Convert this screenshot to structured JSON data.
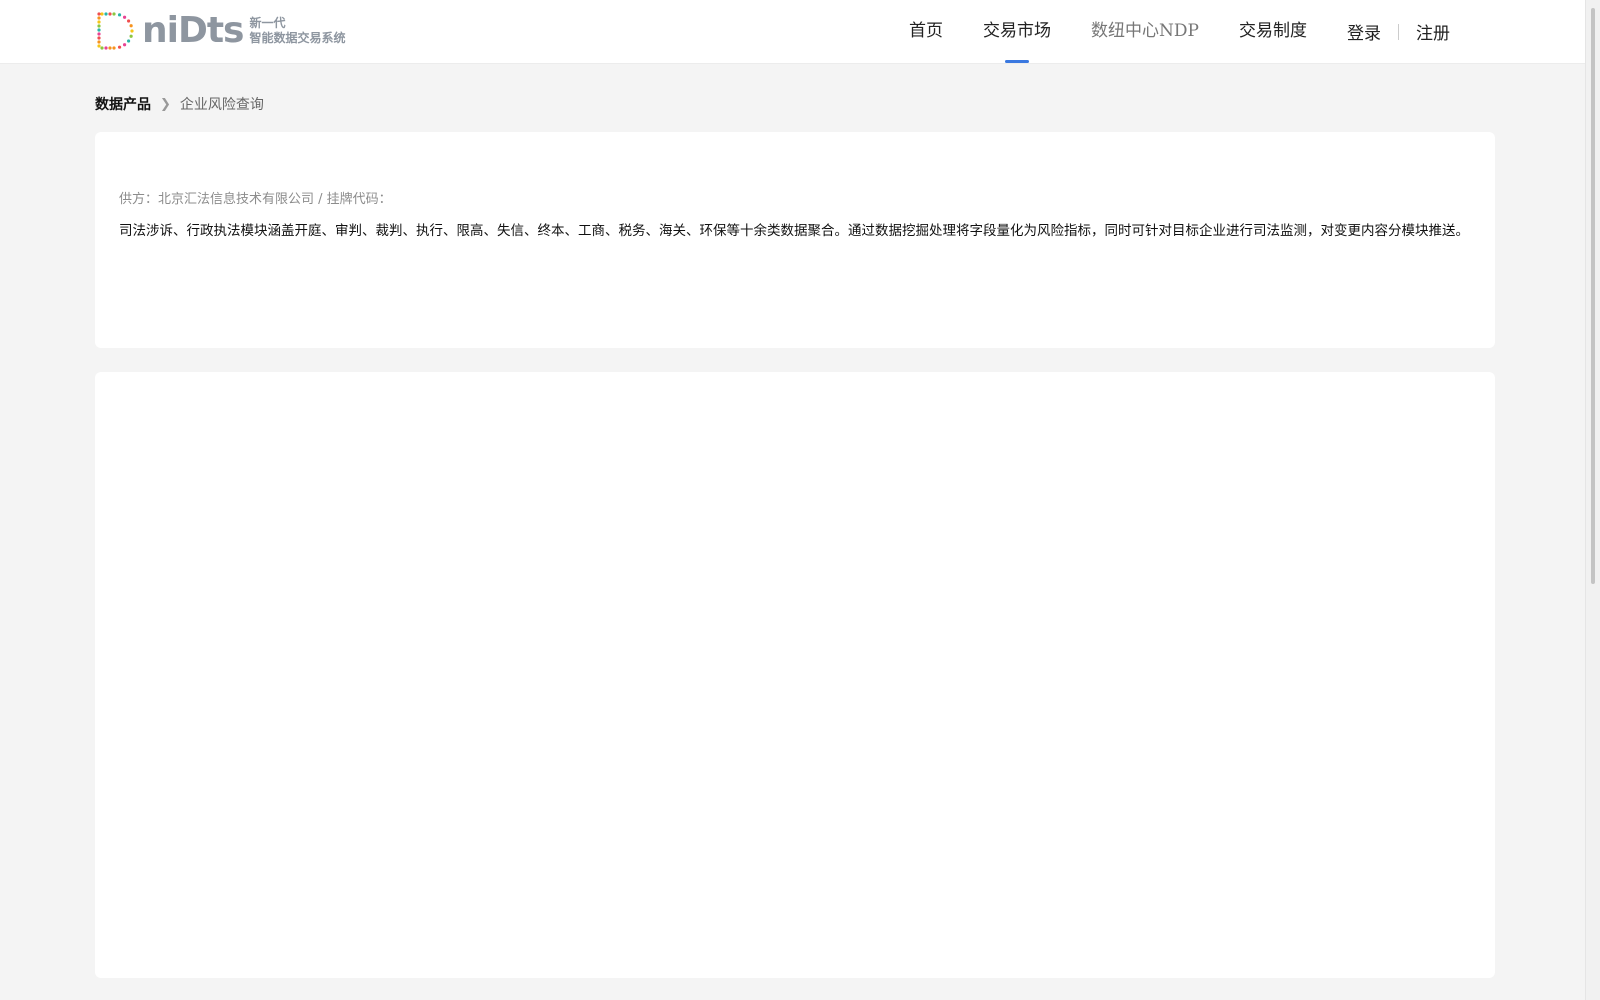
{
  "brand": {
    "word": "niDts",
    "tagline_line1": "新一代",
    "tagline_line2": "智能数据交易系统"
  },
  "nav": {
    "items": [
      {
        "label": "首页"
      },
      {
        "label": "交易市场",
        "active": true
      },
      {
        "label": "数纽中心NDP"
      },
      {
        "label": "交易制度"
      }
    ],
    "login": "登录",
    "register": "注册"
  },
  "breadcrumb": {
    "root": "数据产品",
    "current": "企业风险查询"
  },
  "product": {
    "supplier_line": "供方：北京汇法信息技术有限公司 / 挂牌代码：",
    "description": "司法涉诉、行政执法模块涵盖开庭、审判、裁判、执行、限高、失信、终本、工商、税务、海关、环保等十余类数据聚合。通过数据挖掘处理将字段量化为风险指标，同时可针对目标企业进行司法监测，对变更内容分模块推送。"
  },
  "colors": {
    "accent": "#3a78e0",
    "page_bg": "#f4f4f4"
  }
}
